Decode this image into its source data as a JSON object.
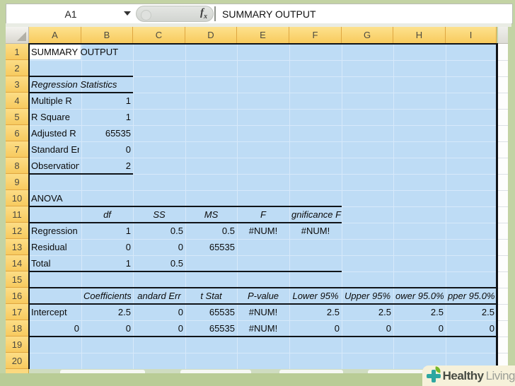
{
  "formula_bar": {
    "cell_reference": "A1",
    "formula": "SUMMARY OUTPUT",
    "fx_label": "fx"
  },
  "sheet": {
    "column_headers": [
      "A",
      "B",
      "C",
      "D",
      "E",
      "F",
      "G",
      "H",
      "I"
    ],
    "row_headers": [
      "1",
      "2",
      "3",
      "4",
      "5",
      "6",
      "7",
      "8",
      "9",
      "10",
      "11",
      "12",
      "13",
      "14",
      "15",
      "16",
      "17",
      "18",
      "19",
      "20"
    ],
    "active_cell": "A1",
    "cells": [
      {
        "r": 1,
        "c": 0,
        "t": "SUMMARY OUTPUT",
        "a": "left",
        "f": true
      },
      {
        "r": 3,
        "c": 0,
        "t": "Regression Statistics",
        "a": "left",
        "i": true,
        "f": true
      },
      {
        "r": 4,
        "c": 0,
        "t": "Multiple R",
        "a": "left"
      },
      {
        "r": 4,
        "c": 1,
        "t": "1",
        "a": "right"
      },
      {
        "r": 5,
        "c": 0,
        "t": "R Square",
        "a": "left"
      },
      {
        "r": 5,
        "c": 1,
        "t": "1",
        "a": "right"
      },
      {
        "r": 6,
        "c": 0,
        "t": "Adjusted R Square",
        "a": "left"
      },
      {
        "r": 6,
        "c": 1,
        "t": "65535",
        "a": "right"
      },
      {
        "r": 7,
        "c": 0,
        "t": "Standard Error",
        "a": "left"
      },
      {
        "r": 7,
        "c": 1,
        "t": "0",
        "a": "right"
      },
      {
        "r": 8,
        "c": 0,
        "t": "Observations",
        "a": "left"
      },
      {
        "r": 8,
        "c": 1,
        "t": "2",
        "a": "right"
      },
      {
        "r": 10,
        "c": 0,
        "t": "ANOVA",
        "a": "left",
        "f": true
      },
      {
        "r": 11,
        "c": 1,
        "t": "df",
        "a": "center",
        "i": true
      },
      {
        "r": 11,
        "c": 2,
        "t": "SS",
        "a": "center",
        "i": true
      },
      {
        "r": 11,
        "c": 3,
        "t": "MS",
        "a": "center",
        "i": true
      },
      {
        "r": 11,
        "c": 4,
        "t": "F",
        "a": "center",
        "i": true
      },
      {
        "r": 11,
        "c": 5,
        "t": "gnificance F",
        "a": "center",
        "i": true,
        "f": true
      },
      {
        "r": 12,
        "c": 0,
        "t": "Regression",
        "a": "left"
      },
      {
        "r": 12,
        "c": 1,
        "t": "1",
        "a": "right"
      },
      {
        "r": 12,
        "c": 2,
        "t": "0.5",
        "a": "right"
      },
      {
        "r": 12,
        "c": 3,
        "t": "0.5",
        "a": "right"
      },
      {
        "r": 12,
        "c": 4,
        "t": "#NUM!",
        "a": "center"
      },
      {
        "r": 12,
        "c": 5,
        "t": "#NUM!",
        "a": "center"
      },
      {
        "r": 13,
        "c": 0,
        "t": "Residual",
        "a": "left"
      },
      {
        "r": 13,
        "c": 1,
        "t": "0",
        "a": "right"
      },
      {
        "r": 13,
        "c": 2,
        "t": "0",
        "a": "right"
      },
      {
        "r": 13,
        "c": 3,
        "t": "65535",
        "a": "right"
      },
      {
        "r": 14,
        "c": 0,
        "t": "Total",
        "a": "left"
      },
      {
        "r": 14,
        "c": 1,
        "t": "1",
        "a": "right"
      },
      {
        "r": 14,
        "c": 2,
        "t": "0.5",
        "a": "right"
      },
      {
        "r": 16,
        "c": 1,
        "t": "Coefficients",
        "a": "center",
        "i": true
      },
      {
        "r": 16,
        "c": 2,
        "t": "andard Err",
        "a": "center",
        "i": true
      },
      {
        "r": 16,
        "c": 3,
        "t": "t Stat",
        "a": "center",
        "i": true
      },
      {
        "r": 16,
        "c": 4,
        "t": "P-value",
        "a": "center",
        "i": true
      },
      {
        "r": 16,
        "c": 5,
        "t": "Lower 95%",
        "a": "center",
        "i": true
      },
      {
        "r": 16,
        "c": 6,
        "t": "Upper 95%",
        "a": "center",
        "i": true
      },
      {
        "r": 16,
        "c": 7,
        "t": "ower 95.0%",
        "a": "center",
        "i": true
      },
      {
        "r": 16,
        "c": 8,
        "t": "pper 95.0%",
        "a": "center",
        "i": true
      },
      {
        "r": 17,
        "c": 0,
        "t": "Intercept",
        "a": "left"
      },
      {
        "r": 17,
        "c": 1,
        "t": "2.5",
        "a": "right"
      },
      {
        "r": 17,
        "c": 2,
        "t": "0",
        "a": "right"
      },
      {
        "r": 17,
        "c": 3,
        "t": "65535",
        "a": "right"
      },
      {
        "r": 17,
        "c": 4,
        "t": "#NUM!",
        "a": "center"
      },
      {
        "r": 17,
        "c": 5,
        "t": "2.5",
        "a": "right"
      },
      {
        "r": 17,
        "c": 6,
        "t": "2.5",
        "a": "right"
      },
      {
        "r": 17,
        "c": 7,
        "t": "2.5",
        "a": "right"
      },
      {
        "r": 17,
        "c": 8,
        "t": "2.5",
        "a": "right"
      },
      {
        "r": 18,
        "c": 0,
        "t": "0",
        "a": "right"
      },
      {
        "r": 18,
        "c": 1,
        "t": "0",
        "a": "right"
      },
      {
        "r": 18,
        "c": 2,
        "t": "0",
        "a": "right"
      },
      {
        "r": 18,
        "c": 3,
        "t": "65535",
        "a": "right"
      },
      {
        "r": 18,
        "c": 4,
        "t": "#NUM!",
        "a": "center"
      },
      {
        "r": 18,
        "c": 5,
        "t": "0",
        "a": "right"
      },
      {
        "r": 18,
        "c": 6,
        "t": "0",
        "a": "right"
      },
      {
        "r": 18,
        "c": 7,
        "t": "0",
        "a": "right"
      },
      {
        "r": 18,
        "c": 8,
        "t": "0",
        "a": "right"
      }
    ]
  },
  "watermark": {
    "healthy": "Healthy",
    "living": "Living"
  },
  "colors": {
    "frame_green": "#c3d3a4",
    "header_amber_top": "#fde28d",
    "header_amber_bottom": "#f8cb5e",
    "selection_blue": "#bedcf5",
    "selection_gridline": "#d7e9fa",
    "selection_border": "#101418",
    "watermark_teal": "#2da7a1",
    "watermark_leaf_green": "#76b82a"
  }
}
